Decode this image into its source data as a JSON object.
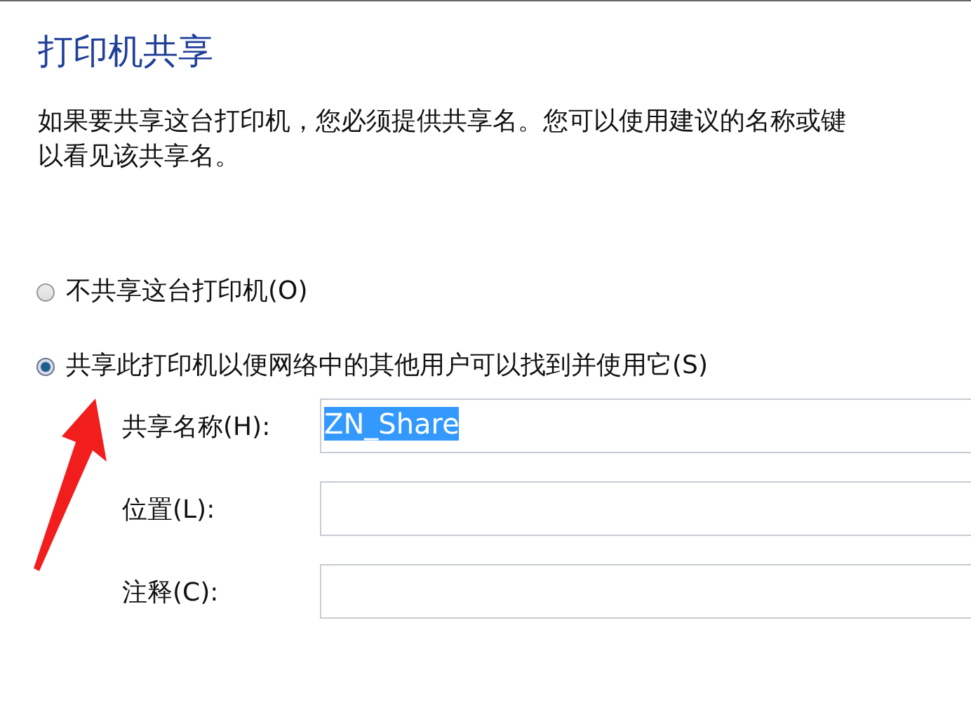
{
  "title": "打印机共享",
  "description_lines": [
    "如果要共享这台打印机，您必须提供共享名。您可以使用建议的名称或键",
    "以看见该共享名。"
  ],
  "options": [
    {
      "label": "不共享这台打印机(O)",
      "selected": false
    },
    {
      "label": "共享此打印机以便网络中的其他用户可以找到并使用它(S)",
      "selected": true
    }
  ],
  "fields": [
    {
      "label": "共享名称(H):",
      "value": "ZN_Share",
      "text_selected": true
    },
    {
      "label": "位置(L):"
    },
    {
      "label": "注释(C):"
    }
  ]
}
